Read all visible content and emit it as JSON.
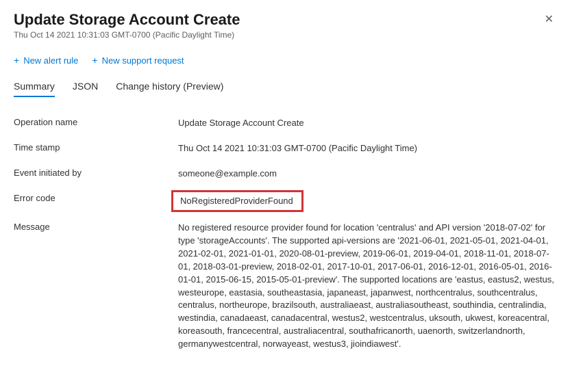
{
  "header": {
    "title": "Update Storage Account Create",
    "subtitle": "Thu Oct 14 2021 10:31:03 GMT-0700 (Pacific Daylight Time)"
  },
  "toolbar": {
    "new_alert_label": "New alert rule",
    "new_support_label": "New support request"
  },
  "tabs": {
    "summary": "Summary",
    "json": "JSON",
    "change_history": "Change history (Preview)"
  },
  "details": {
    "operation_name": {
      "label": "Operation name",
      "value": "Update Storage Account Create"
    },
    "time_stamp": {
      "label": "Time stamp",
      "value": "Thu Oct 14 2021 10:31:03 GMT-0700 (Pacific Daylight Time)"
    },
    "event_initiated_by": {
      "label": "Event initiated by",
      "value": "someone@example.com"
    },
    "error_code": {
      "label": "Error code",
      "value": "NoRegisteredProviderFound"
    },
    "message": {
      "label": "Message",
      "value": "No registered resource provider found for location 'centralus' and API version '2018-07-02' for type 'storageAccounts'. The supported api-versions are '2021-06-01, 2021-05-01, 2021-04-01, 2021-02-01, 2021-01-01, 2020-08-01-preview, 2019-06-01, 2019-04-01, 2018-11-01, 2018-07-01, 2018-03-01-preview, 2018-02-01, 2017-10-01, 2017-06-01, 2016-12-01, 2016-05-01, 2016-01-01, 2015-06-15, 2015-05-01-preview'. The supported locations are 'eastus, eastus2, westus, westeurope, eastasia, southeastasia, japaneast, japanwest, northcentralus, southcentralus, centralus, northeurope, brazilsouth, australiaeast, australiasoutheast, southindia, centralindia, westindia, canadaeast, canadacentral, westus2, westcentralus, uksouth, ukwest, koreacentral, koreasouth, francecentral, australiacentral, southafricanorth, uaenorth, switzerlandnorth, germanywestcentral, norwayeast, westus3, jioindiawest'."
    }
  }
}
